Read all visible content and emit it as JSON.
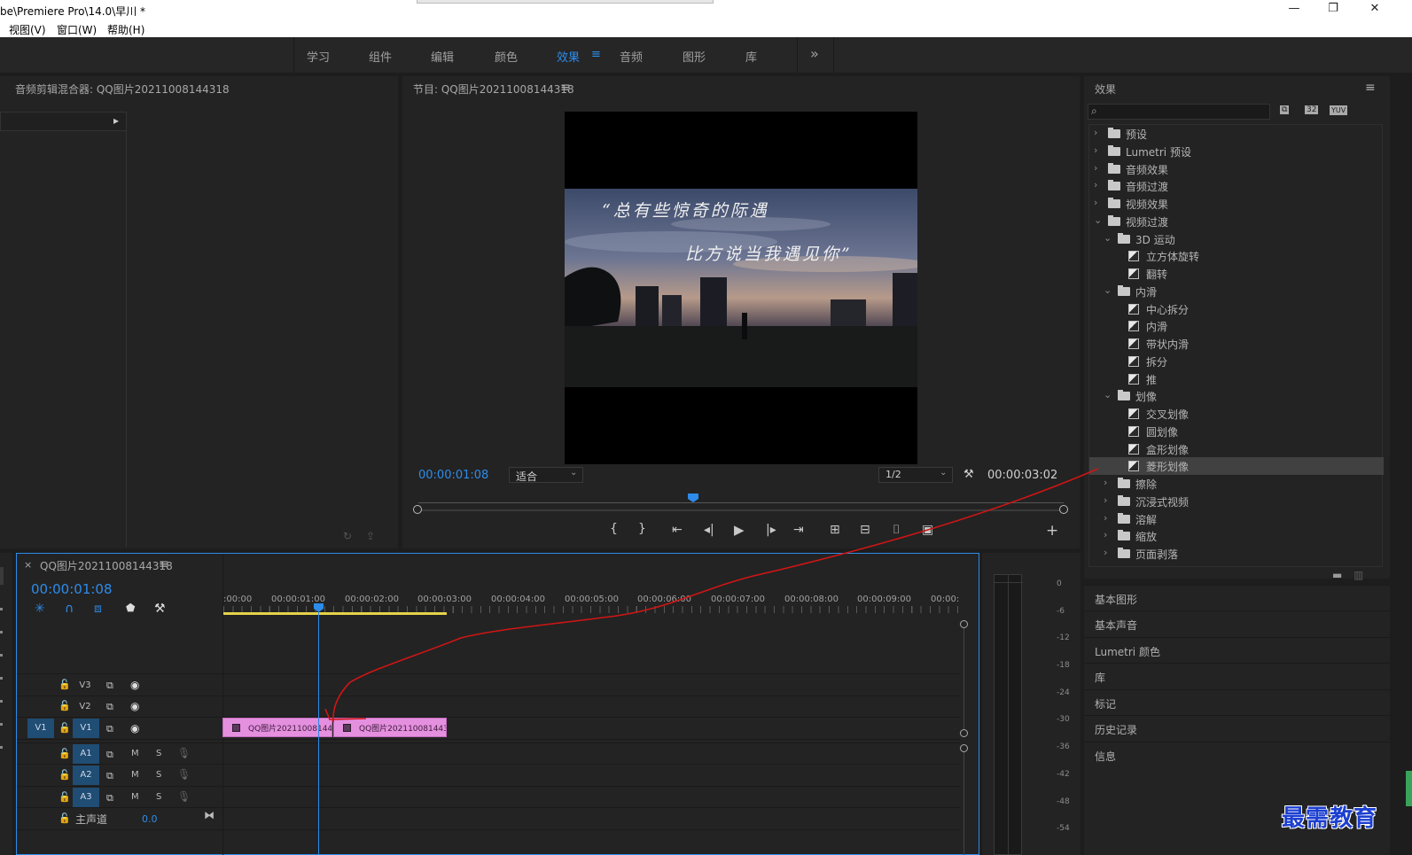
{
  "window": {
    "title": "be\\Premiere Pro\\14.0\\早川 *",
    "min_glyph": "—",
    "restore_glyph": "❐",
    "close_glyph": "✕"
  },
  "menu": [
    "视图(V)",
    "窗口(W)",
    "帮助(H)"
  ],
  "workspaces": [
    {
      "label": "学习",
      "active": false
    },
    {
      "label": "组件",
      "active": false
    },
    {
      "label": "编辑",
      "active": false
    },
    {
      "label": "颜色",
      "active": false
    },
    {
      "label": "效果",
      "active": true
    },
    {
      "label": "音频",
      "active": false
    },
    {
      "label": "图形",
      "active": false
    },
    {
      "label": "库",
      "active": false
    }
  ],
  "workspace_menu_glyph": "≡",
  "workspace_overflow": "»",
  "audio_mixer": {
    "title": "音频剪辑混合器: QQ图片20211008144318",
    "arrow": "▸",
    "loop_icon": "↻",
    "export_icon": "⇪"
  },
  "program_monitor": {
    "title": "节目: QQ图片20211008144318",
    "menu_glyph": "≡",
    "timecode": "00:00:01:08",
    "fit_label": "适合",
    "resolution": "1/2",
    "duration": "00:00:03:02",
    "caption_line1": "“总有些惊奇的际遇",
    "caption_line2": "比方说当我遇见你”",
    "settings_icon": "🔧",
    "add_button": "+"
  },
  "transport": [
    "marker",
    "in",
    "out",
    "go-to-in",
    "step-back",
    "play",
    "step-forward",
    "go-to-out",
    "insert",
    "overwrite",
    "export-frame",
    "compare"
  ],
  "transport_glyphs": {
    "marker": "⬟",
    "in": "{",
    "out": "}",
    "go-to-in": "⇤",
    "step-back": "◀|",
    "play": "▶",
    "step-forward": "|▶",
    "go-to-out": "⇥",
    "insert": "⊞",
    "overwrite": "⊟",
    "export-frame": "📷",
    "compare": "▣"
  },
  "effects_panel": {
    "title": "效果",
    "menu_glyph": "≡",
    "search_placeholder": "",
    "search_glyph": "⌕",
    "filter_badges": [
      "⧉",
      "32",
      "YUV"
    ],
    "tree": [
      {
        "label": "预设",
        "level": 0,
        "type": "folder-special",
        "expanded": false
      },
      {
        "label": "Lumetri 预设",
        "level": 0,
        "type": "folder-special",
        "expanded": false
      },
      {
        "label": "音频效果",
        "level": 0,
        "type": "folder",
        "expanded": false
      },
      {
        "label": "音频过渡",
        "level": 0,
        "type": "folder",
        "expanded": false
      },
      {
        "label": "视频效果",
        "level": 0,
        "type": "folder",
        "expanded": false
      },
      {
        "label": "视频过渡",
        "level": 0,
        "type": "folder",
        "expanded": true
      },
      {
        "label": "3D 运动",
        "level": 1,
        "type": "folder",
        "expanded": true
      },
      {
        "label": "立方体旋转",
        "level": 2,
        "type": "effect"
      },
      {
        "label": "翻转",
        "level": 2,
        "type": "effect"
      },
      {
        "label": "内滑",
        "level": 1,
        "type": "folder",
        "expanded": true
      },
      {
        "label": "中心拆分",
        "level": 2,
        "type": "effect"
      },
      {
        "label": "内滑",
        "level": 2,
        "type": "effect"
      },
      {
        "label": "带状内滑",
        "level": 2,
        "type": "effect"
      },
      {
        "label": "拆分",
        "level": 2,
        "type": "effect"
      },
      {
        "label": "推",
        "level": 2,
        "type": "effect"
      },
      {
        "label": "划像",
        "level": 1,
        "type": "folder",
        "expanded": true
      },
      {
        "label": "交叉划像",
        "level": 2,
        "type": "effect"
      },
      {
        "label": "圆划像",
        "level": 2,
        "type": "effect"
      },
      {
        "label": "盒形划像",
        "level": 2,
        "type": "effect"
      },
      {
        "label": "菱形划像",
        "level": 2,
        "type": "effect",
        "selected": true
      },
      {
        "label": "擦除",
        "level": 1,
        "type": "folder",
        "expanded": false
      },
      {
        "label": "沉浸式视频",
        "level": 1,
        "type": "folder",
        "expanded": false
      },
      {
        "label": "溶解",
        "level": 1,
        "type": "folder",
        "expanded": false
      },
      {
        "label": "缩放",
        "level": 1,
        "type": "folder",
        "expanded": false
      },
      {
        "label": "页面剥落",
        "level": 1,
        "type": "folder",
        "expanded": false
      }
    ],
    "new_bin_icon": "▬",
    "delete_icon": "🗑"
  },
  "side_panels": [
    "基本图形",
    "基本声音",
    "Lumetri 颜色",
    "库",
    "标记",
    "历史记录",
    "信息"
  ],
  "timeline": {
    "close_glyph": "×",
    "tab_title": "QQ图片20211008144318",
    "menu_glyph": "≡",
    "timecode": "00:00:01:08",
    "tool_icons": [
      "✳",
      "∩",
      "⧈",
      "⬟",
      "🔧"
    ],
    "ruler": [
      ":00:00",
      "00:00:01:00",
      "00:00:02:00",
      "00:00:03:00",
      "00:00:04:00",
      "00:00:05:00",
      "00:00:06:00",
      "00:00:07:00",
      "00:00:08:00",
      "00:00:09:00",
      "00:00:"
    ],
    "video_tracks": [
      {
        "name": "V3",
        "source": ""
      },
      {
        "name": "V2",
        "source": ""
      },
      {
        "name": "V1",
        "source": "V1"
      }
    ],
    "audio_tracks": [
      {
        "name": "A1",
        "m": "M",
        "s": "S"
      },
      {
        "name": "A2",
        "m": "M",
        "s": "S"
      },
      {
        "name": "A3",
        "m": "M",
        "s": "S"
      }
    ],
    "master": {
      "label": "主声道",
      "value": "0.0",
      "glyph": "⧓"
    },
    "clips": [
      {
        "label": "QQ图片20211008144"
      },
      {
        "label": "QQ图片202110081443"
      }
    ],
    "lock_glyph": "🔓",
    "film_glyph": "⧉",
    "eye_glyph": "◉",
    "mic_glyph": "🎙"
  },
  "audio_meter": {
    "labels": [
      "0",
      "-6",
      "-12",
      "-18",
      "-24",
      "-30",
      "-36",
      "-42",
      "-48",
      "-54"
    ]
  },
  "watermark": "最需教育",
  "colors": {
    "accent": "#2d8ceb",
    "clip": "#e58fdf",
    "track_target": "#1f4d73",
    "annotation": "#d01515",
    "work_area": "#e5d24a"
  }
}
